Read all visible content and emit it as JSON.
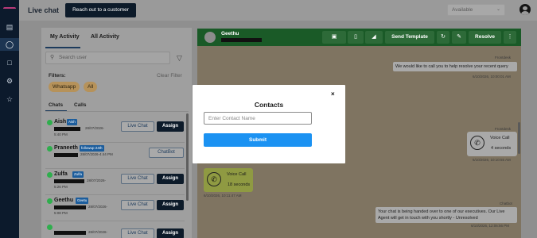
{
  "topbar": {
    "title": "Live chat",
    "reach_button": "Reach out to a customer",
    "availability": "Available"
  },
  "rail": {
    "icons": [
      "chart-icon",
      "headset-icon",
      "document-icon",
      "gear-icon",
      "star-icon"
    ]
  },
  "left_panel": {
    "tabs": [
      {
        "label": "My Activity",
        "active": true
      },
      {
        "label": "All Activity",
        "active": false
      }
    ],
    "search_placeholder": "Search user",
    "filters_label": "Filters:",
    "clear_filter": "Clear Filter",
    "chips": [
      "Whatsapp",
      "All"
    ],
    "subtabs": [
      {
        "label": "Chats",
        "active": true
      },
      {
        "label": "Calls",
        "active": false
      }
    ],
    "rows": [
      {
        "name": "Aish",
        "badge": "Aish",
        "date": "28/07/2026-",
        "time": "5:40 PM",
        "action": "Live Chat",
        "assign": "Assign"
      },
      {
        "name": "Praneeth",
        "badge": "followup 24th",
        "date": "28/07/2026-4:44 PM",
        "time": "",
        "action": "ChatBot",
        "assign": ""
      },
      {
        "name": "Zulfa",
        "badge": "Zulfa",
        "date": "28/07/2026-",
        "time": "5:26 PM",
        "action": "Live Chat",
        "assign": "Assign"
      },
      {
        "name": "Geethu",
        "badge": "Geetu",
        "date": "28/07/2026-",
        "time": "5:08 PM",
        "action": "Live Chat",
        "assign": "Assign"
      },
      {
        "name": "",
        "badge": "",
        "date": "28/07/2026-",
        "time": "",
        "action": "Live Chat",
        "assign": "Assign"
      }
    ]
  },
  "chat": {
    "contact_name": "Geethu",
    "header_buttons": {
      "send_template": "Send Template",
      "resolve": "Resolve"
    },
    "messages": [
      {
        "sender": "Frontdesk",
        "text": "We would like to call you to help resolve your recent query",
        "timestamp": "6/10/2026, 10:00:01 AM"
      },
      {
        "sender": "Frontdesk",
        "call_label": "Voice Call",
        "call_duration": "4 seconds",
        "timestamp": "6/10/2026, 10:10:55 AM"
      },
      {
        "sender": "",
        "call_label": "Voice Call",
        "call_duration": "18 seconds",
        "timestamp": "6/10/2026, 10:11:47 AM"
      },
      {
        "sender": "Chatbot",
        "text": "Your chat is being handed over to one of our executives. Our Live Agent will get in touch with you shortly - Unresolved",
        "timestamp": "6/10/2026, 12:06:56 PM"
      }
    ]
  },
  "modal": {
    "title": "Contacts",
    "input_placeholder": "Enter Contact Name",
    "submit_label": "Submit",
    "close_symbol": "×"
  },
  "colors": {
    "brand_dark": "#0d1b2a",
    "header_green": "#1a5a27",
    "submit_blue": "#1b92f2",
    "chip_gold": "#b6925a",
    "badge_blue": "#1c5d9c"
  }
}
